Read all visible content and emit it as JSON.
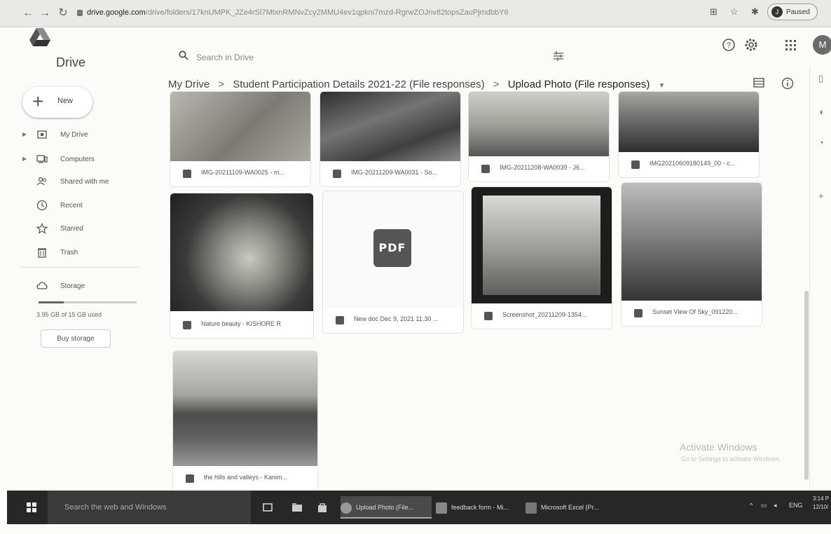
{
  "browser": {
    "url_host": "drive.google.com",
    "url_path": "/drive/folders/17knUMPK_JZe4rSl7MtxnRMNvZcy2MMU4ev1qpkni7mzd-RgrwZOJnv82topsZauPjmdbbY6",
    "paused_label": "Paused",
    "profile_initial": "J"
  },
  "header": {
    "brand": "Drive",
    "search_placeholder": "Search in Drive",
    "user_initial": "M"
  },
  "breadcrumb": {
    "items": [
      "My Drive",
      "Student Participation Details 2021-22 (File responses)",
      "Upload Photo (File responses)"
    ],
    "separator": ">"
  },
  "sidebar": {
    "new_label": "New",
    "items": [
      {
        "label": "My Drive",
        "icon": "my-drive-icon",
        "expandable": true
      },
      {
        "label": "Computers",
        "icon": "computers-icon",
        "expandable": true
      },
      {
        "label": "Shared with me",
        "icon": "shared-icon",
        "expandable": false
      },
      {
        "label": "Recent",
        "icon": "clock-icon",
        "expandable": false
      },
      {
        "label": "Starred",
        "icon": "star-icon",
        "expandable": false
      },
      {
        "label": "Trash",
        "icon": "trash-icon",
        "expandable": false
      }
    ],
    "storage_label": "Storage",
    "storage_used_text": "3.95 GB of 15 GB used",
    "storage_fraction": 0.26,
    "buy_storage_label": "Buy storage"
  },
  "files": [
    {
      "name": "IMG-20211109-WA0025 - m...",
      "type": "image"
    },
    {
      "name": "IMG-20211209-WA0031 - So...",
      "type": "image"
    },
    {
      "name": "IMG-20211208-WA0039 - J6...",
      "type": "image"
    },
    {
      "name": "IMG20210609180149_00 - c...",
      "type": "image"
    },
    {
      "name": "Nature beauty - KISHORE R",
      "type": "image"
    },
    {
      "name": "New doc Dec 9, 2021 11.30 ...",
      "type": "pdf",
      "badge": "PDF"
    },
    {
      "name": "Screenshot_20211209-1354...",
      "type": "image"
    },
    {
      "name": "Sunset View Of Sky_091220...",
      "type": "image"
    },
    {
      "name": "the hills and valleys - Kanim...",
      "type": "image"
    }
  ],
  "watermark": {
    "title": "Activate Windows",
    "subtitle": "Go to Settings to activate Windows."
  },
  "taskbar": {
    "search_placeholder": "Search the web and Windows",
    "apps": [
      {
        "label": "Upload Photo (File...",
        "active": true
      },
      {
        "label": "feedback form - Mi...",
        "active": false
      },
      {
        "label": "Microsoft Excel (Pr...",
        "active": false
      }
    ],
    "lang": "ENG",
    "time": "3:14 P",
    "date": "12/10/"
  },
  "colors": {
    "accent": "#555555",
    "taskbar": "#272727",
    "background": "#fbfbfa"
  }
}
